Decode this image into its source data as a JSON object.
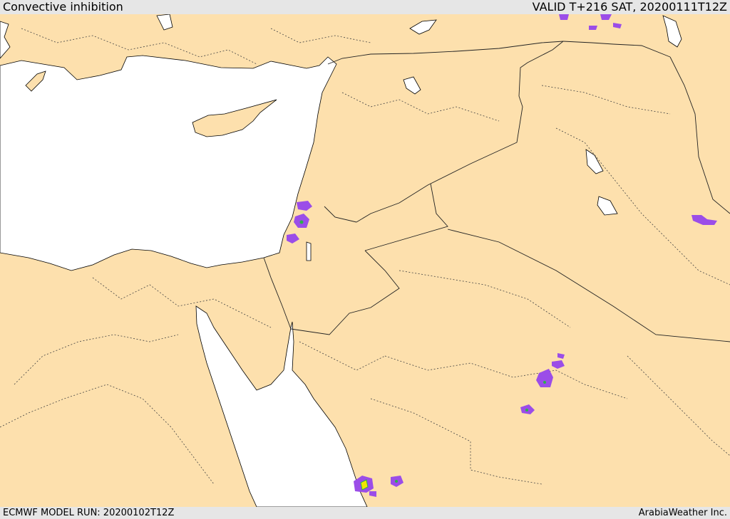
{
  "header": {
    "title": "Convective inhibition",
    "valid": "VALID T+216 SAT, 20200111T12Z"
  },
  "footer": {
    "model_run": "ECMWF MODEL RUN: 20200102T12Z",
    "credit": "ArabiaWeather Inc."
  },
  "colors": {
    "land": "#fde0ad",
    "water": "#ffffff",
    "coast": "#000000",
    "border": "#222222",
    "cin_weak": "#9b4de8",
    "cin_mid": "#2bb34a",
    "cin_strong": "#f2e600"
  }
}
